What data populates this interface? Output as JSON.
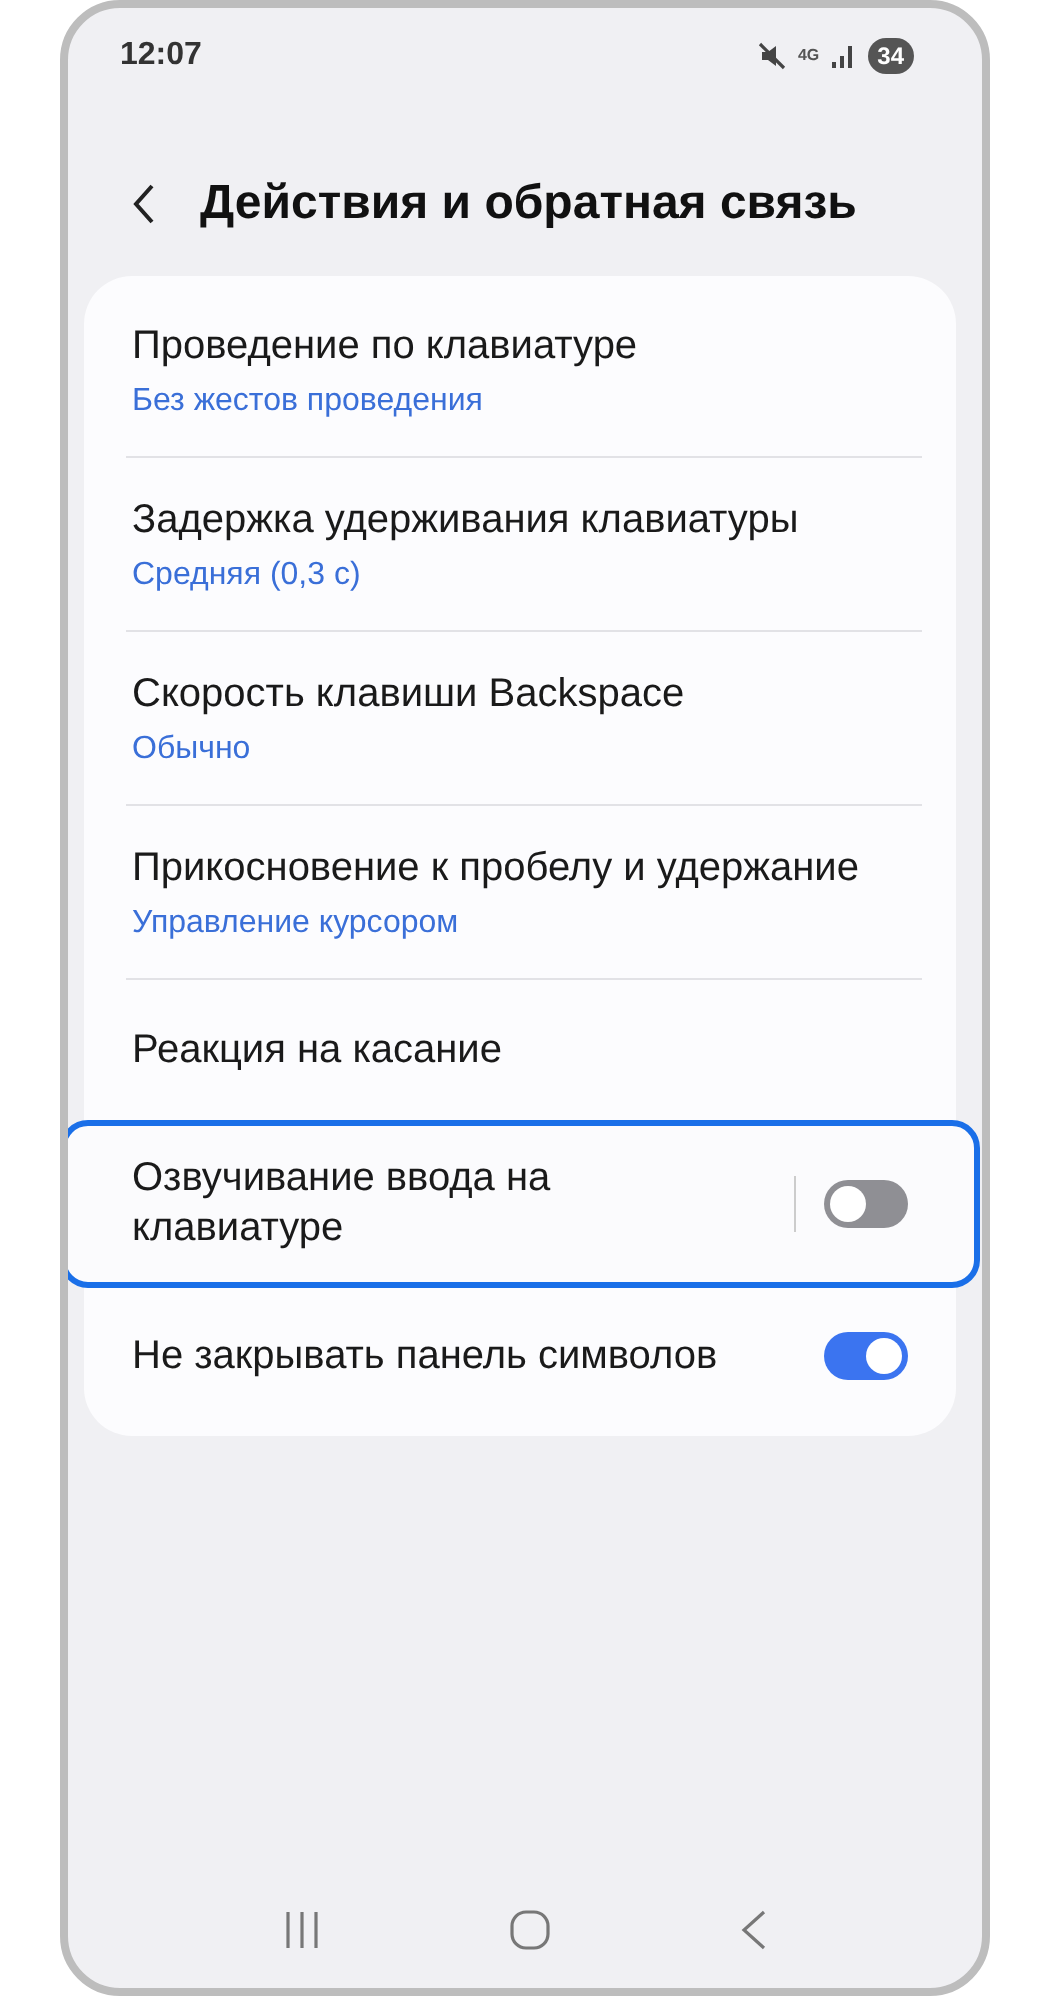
{
  "status_bar": {
    "time": "12:07",
    "network": "4G",
    "battery": "34"
  },
  "header": {
    "title": "Действия и обратная связь"
  },
  "settings": [
    {
      "kind": "subtitle",
      "title": "Проведение по клавиатуре",
      "subtitle": "Без жестов проведения",
      "highlighted": false
    },
    {
      "kind": "subtitle",
      "title": "Задержка удерживания клавиатуры",
      "subtitle": "Средняя (0,3 с)",
      "highlighted": false
    },
    {
      "kind": "subtitle",
      "title": "Скорость клавиши Backspace",
      "subtitle": "Обычно",
      "highlighted": false
    },
    {
      "kind": "subtitle",
      "title": "Прикосновение к пробелу и удержание",
      "subtitle": "Управление курсором",
      "highlighted": false
    },
    {
      "kind": "plain",
      "title": "Реакция на касание",
      "highlighted": false
    },
    {
      "kind": "toggle",
      "title": "Озвучивание ввода на клавиатуре",
      "on": false,
      "highlighted": true
    },
    {
      "kind": "toggle",
      "title": "Не закрывать панель символов",
      "on": true,
      "highlighted": false
    }
  ]
}
